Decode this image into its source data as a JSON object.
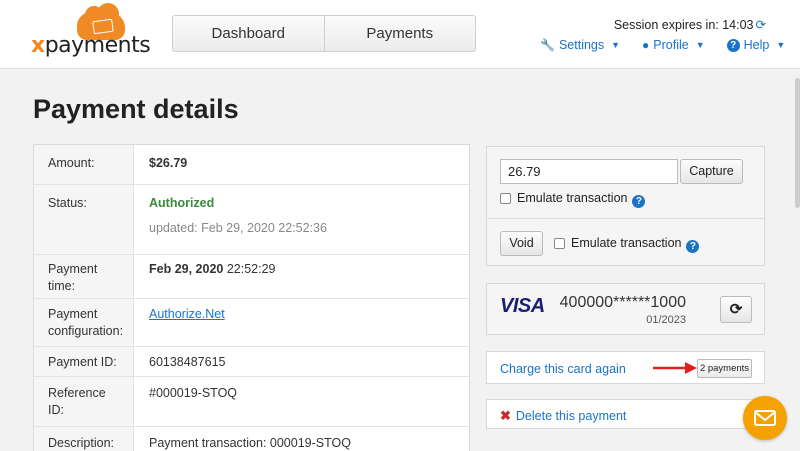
{
  "app": {
    "logo_prefix": "x",
    "logo_text": "payments"
  },
  "nav": {
    "tabs": [
      {
        "label": "Dashboard"
      },
      {
        "label": "Payments"
      }
    ]
  },
  "session": {
    "text": "Session expires in: 14:03"
  },
  "menu": {
    "settings": "Settings",
    "profile": "Profile",
    "help": "Help"
  },
  "page": {
    "title": "Payment details"
  },
  "details": {
    "amount_label": "Amount:",
    "amount_value": "$26.79",
    "status_label": "Status:",
    "status_value": "Authorized",
    "status_updated": "updated: Feb 29, 2020 22:52:36",
    "time_label": "Payment time:",
    "time_date": "Feb 29, 2020",
    "time_clock": "22:52:29",
    "config_label": "Payment configuration:",
    "config_value": "Authorize.Net",
    "id_label": "Payment ID:",
    "id_value": "60138487615",
    "ref_label": "Reference ID:",
    "ref_value": "#000019-STOQ",
    "desc_label": "Description:",
    "desc_value": "Payment transaction: 000019-STOQ"
  },
  "capture": {
    "amount_value": "26.79",
    "capture_label": "Capture",
    "emulate_label": "Emulate transaction",
    "void_label": "Void",
    "void_emulate_label": "Emulate transaction"
  },
  "card": {
    "brand": "VISA",
    "number": "400000******1000",
    "expiry": "01/2023"
  },
  "charge": {
    "link": "Charge this card again",
    "badge": "2 payments"
  },
  "delete": {
    "link": "Delete this payment"
  },
  "colors": {
    "accent": "#1a73c8",
    "brand_orange": "#f08a24",
    "authorized_green": "#3c8a3c",
    "delete_red": "#c0302a",
    "arrow_red": "#e02020",
    "chat_bg": "#f5a100"
  },
  "icons": {
    "refresh": "refresh-icon",
    "wrench": "wrench-icon",
    "user": "user-icon",
    "question": "question-icon",
    "times": "close-icon",
    "envelope": "envelope-icon"
  }
}
